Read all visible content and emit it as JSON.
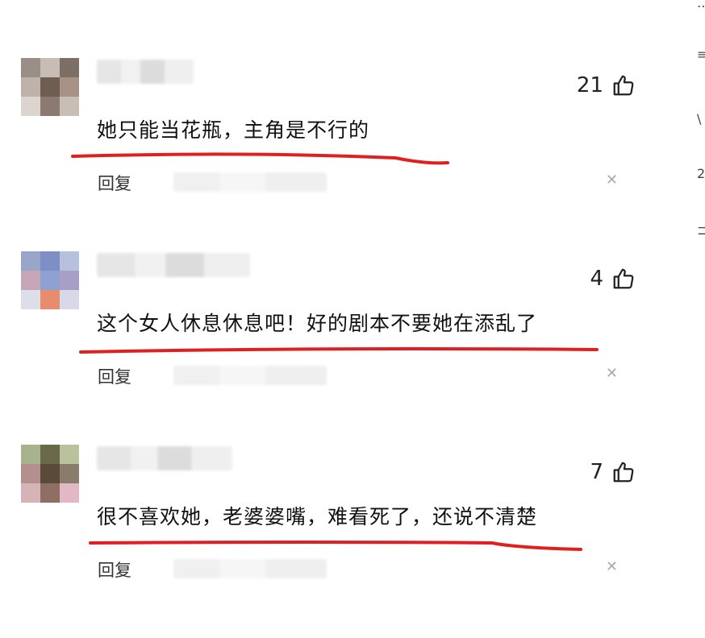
{
  "comments": [
    {
      "likes": "21",
      "text": "她只能当花瓶，主角是不行的",
      "reply_label": "回复",
      "avatar_colors": [
        "#9a8e88",
        "#c8bdb5",
        "#7d6f66",
        "#bfb2aa",
        "#6f5d52",
        "#a89286",
        "#dcd4cf",
        "#8c7a70",
        "#c9beb6"
      ],
      "underline_color": "#e02020"
    },
    {
      "likes": "4",
      "text": "这个女人休息休息吧！好的剧本不要她在添乱了",
      "reply_label": "回复",
      "avatar_colors": [
        "#9aa6c8",
        "#7d8fc4",
        "#b7c0dc",
        "#c4a6b6",
        "#8ea1d3",
        "#a79fc6",
        "#dcdfe9",
        "#e88c6e",
        "#d7d9e8"
      ],
      "underline_color": "#e02020"
    },
    {
      "likes": "7",
      "text": "很不喜欢她，老婆婆嘴，难看死了，还说不清楚",
      "reply_label": "回复",
      "avatar_colors": [
        "#a7b38d",
        "#6a6a48",
        "#b9c29c",
        "#b48f8d",
        "#5a4a3a",
        "#8a7c6a",
        "#d6b3b7",
        "#8f6f64",
        "#e3b8c4"
      ],
      "underline_color": "#e02020"
    }
  ],
  "edge_glyphs": [
    "⋯",
    "≡",
    "\\",
    "2",
    "⊐"
  ]
}
